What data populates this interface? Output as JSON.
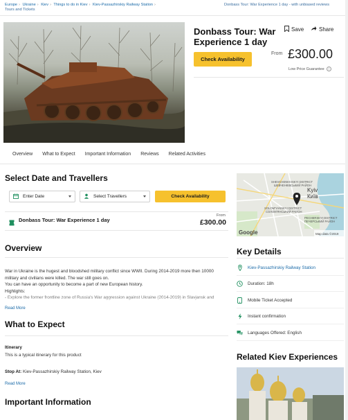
{
  "breadcrumb": {
    "items": [
      "Europe",
      "Ukraine",
      "Kiev",
      "Things to do in Kiev",
      "Kiev-Passazhirskiy Railway Station"
    ],
    "last": "Tours and Tickets",
    "right": "Donbass Tour: War Experience 1 day - with unbiased reviews"
  },
  "header": {
    "title": "Donbass Tour: War Experience 1 day",
    "save_label": "Save",
    "share_label": "Share",
    "check_label": "Check Availability",
    "from_label": "From",
    "price": "£300.00",
    "guarantee": "Low Price Guarantee"
  },
  "tabs": [
    "Overview",
    "What to Expect",
    "Important Information",
    "Reviews",
    "Related Activities"
  ],
  "booking": {
    "title": "Select Date and Travellers",
    "date_placeholder": "Enter Date",
    "travellers_placeholder": "Select Travellers",
    "check_label": "Check Availability",
    "product_name": "Donbass Tour: War Experience 1 day",
    "from_label": "From",
    "price": "£300.00"
  },
  "map": {
    "labels": [
      "SHEVCHENKIVSKYI DISTRICT",
      "ШЕВЧЕНКІВСЬКИЙ РАЙОН",
      "Kyiv",
      "Київ",
      "SOLOM'YANSKYI DISTRICT",
      "СОЛОМ'ЯНСЬКИЙ РАЙОН",
      "PECHERSKYI DISTRICT",
      "ПЕЧЕРСЬКИЙ РАЙОН"
    ],
    "logo": "Google",
    "copyright": "Map data ©2019"
  },
  "overview": {
    "title": "Overview",
    "lines": [
      "War in Ukraine is the hugest and bloodshed military conflict since WWII. During 2014-2019 more then 10000",
      "military and civilians were killed. The war still goes on.",
      "You can have an opportunity to become a part of new European history.",
      "Highlights:",
      "- Explore the former frontline zone of Russia's War aggression against Ukraine (2014-2019) in Slavjansk and"
    ],
    "read_more": "Read More"
  },
  "what_to_expect": {
    "title": "What to Expect",
    "itinerary_label": "Itinerary",
    "itinerary_text": "This is a typical itinerary for this product",
    "stop_label": "Stop At:",
    "stop_value": "Kiev-Passazhirskiy Railway Station, Kiev",
    "read_more": "Read More"
  },
  "important": {
    "title": "Important Information"
  },
  "key_details": {
    "title": "Key Details",
    "items": [
      {
        "icon": "location-pin-icon",
        "text": "Kiev-Passazhirskiy Railway Station",
        "link": true
      },
      {
        "icon": "clock-icon",
        "text": "Duration: 18h",
        "link": false
      },
      {
        "icon": "ticket-icon",
        "text": "Mobile Ticket Accepted",
        "link": false
      },
      {
        "icon": "lightning-icon",
        "text": "Instant confirmation",
        "link": false
      },
      {
        "icon": "chat-icon",
        "text": "Languages Offered: English",
        "link": false
      }
    ]
  },
  "related": {
    "title": "Related Kiev Experiences"
  },
  "colors": {
    "accent": "#f6c12d",
    "link": "#1a6aa8",
    "brand_green": "#1f8f5f"
  }
}
